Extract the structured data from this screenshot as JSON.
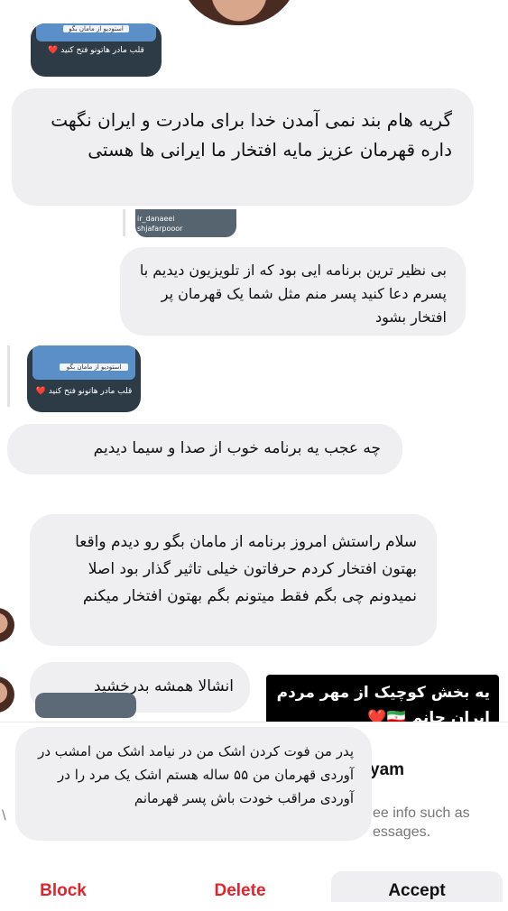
{
  "thumb_top": {
    "caption": "قلب مادر هاتونو فتح کنید ❤️",
    "banner": "استودیو از مامان بگو"
  },
  "messages": [
    {
      "text": "گریه هام بند نمی آمدن خدا برای مادرت و ایران نگهت داره قهرمان عزیز مایه افتخار ما ایرانی ها هستی"
    },
    {
      "text": "بی نظیر ترین برنامه ایی بود که از تلویزیون دیدیم با پسرم دعا کنید پسر منم مثل شما یک قهرمان پر افتخار بشود"
    },
    {
      "text": "چه عجب یه برنامه خوب از صدا و سیما دیدیم"
    },
    {
      "text": "سلام راستش امروز برنامه از مامان بگو رو دیدم واقعا بهتون افتخار کردم حرفاتون خیلی تاثیر گذار بود اصلا نمیدونم چی بگم فقط میتونم بگم بهتون افتخار میکنم"
    },
    {
      "text": "انشالا همشه بدرخشید"
    },
    {
      "text": "پدر من فوت کردن اشک من در نیامد اشک من امشب در آوردی قهرمان من ۵۵ ساله هستم اشک یک مرد را در آوردی مراقب خودت باش پسر قهرمانم"
    }
  ],
  "thumb_mid": {
    "caption": "قلب مادر هاتونو فتح کنید ❤️",
    "banner": "استودیو از مامان بگو"
  },
  "story_mentions": [
    "ir_danaeei",
    "shjafarpooor"
  ],
  "overlay_caption": {
    "line1": "یه بخش کوچیک از مهر مردم",
    "line2": "ایران جانم 🇮🇷❤️"
  },
  "request_panel": {
    "name_partial": "yam",
    "info_partial_1": "ee info such as",
    "info_partial_2": "essages.",
    "left_glyph": "\\"
  },
  "actions": {
    "block": "Block",
    "delete": "Delete",
    "accept": "Accept"
  },
  "colors": {
    "block": "#e0242c",
    "delete": "#e0242c",
    "accept": "#111111",
    "bubble": "#efeff1"
  }
}
